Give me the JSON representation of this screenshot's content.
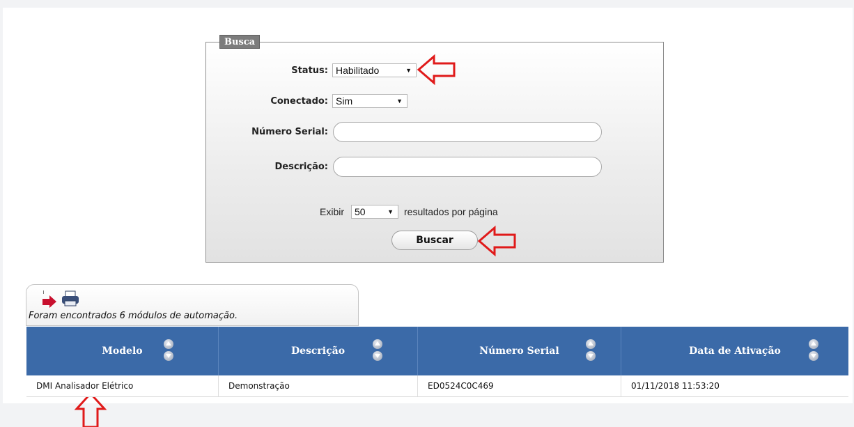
{
  "search": {
    "legend": "Busca",
    "status": {
      "label": "Status:",
      "value": "Habilitado"
    },
    "conectado": {
      "label": "Conectado:",
      "value": "Sim"
    },
    "numero_serial": {
      "label": "Número Serial:",
      "value": ""
    },
    "descricao": {
      "label": "Descrição:",
      "value": ""
    },
    "exibir_label": "Exibir",
    "per_page_value": "50",
    "per_page_suffix": "resultados por página",
    "submit_label": "Buscar"
  },
  "results": {
    "summary": "Foram encontrados 6 módulos de automação.",
    "toolbar_icons": [
      "export-icon",
      "print-icon"
    ],
    "columns": [
      "Modelo",
      "Descrição",
      "Número Serial",
      "Data de Ativação"
    ],
    "rows": [
      [
        "DMI Analisador Elétrico",
        "Demonstração",
        "ED0524C0C469",
        "01/11/2018 11:53:20"
      ]
    ]
  },
  "colors": {
    "header_bg": "#3b6aa8",
    "annotation_arrow": "#e01a1a"
  },
  "icons": {
    "dropdown": "triangle-down",
    "sort": "up-down-circles"
  }
}
